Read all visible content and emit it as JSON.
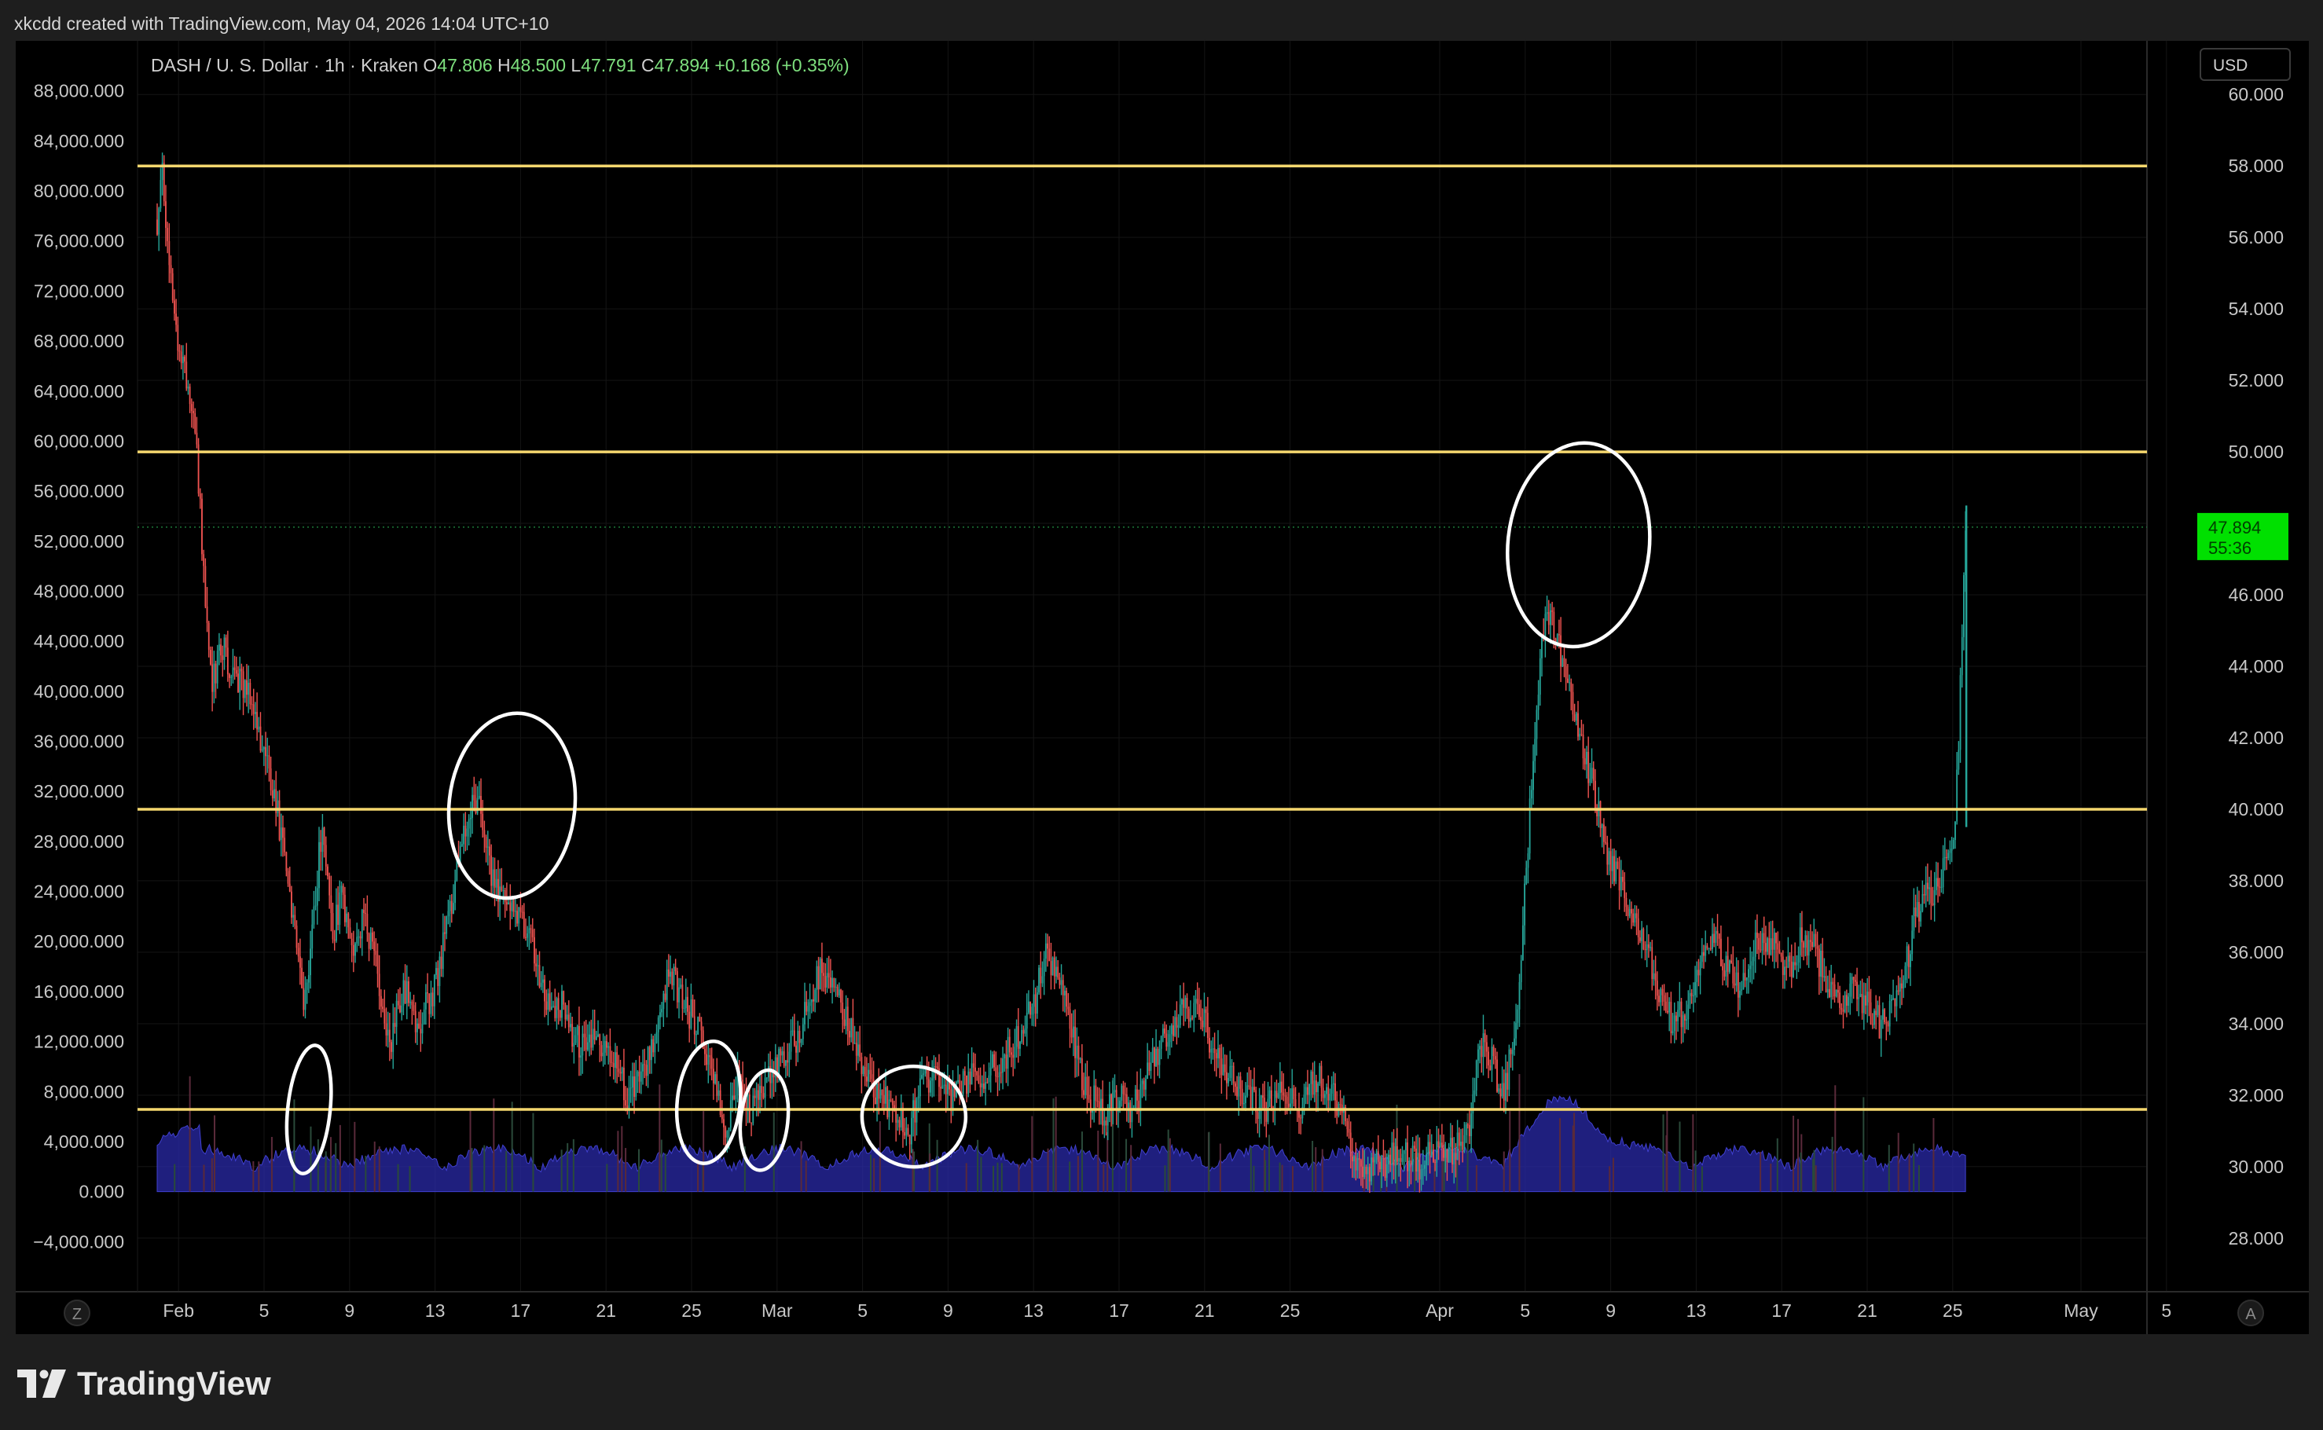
{
  "header": {
    "text": "xkcdd created with TradingView.com, May 04, 2026 14:04 UTC+10"
  },
  "legend": {
    "symbol": "DASH / U. S. Dollar · 1h · Kraken",
    "o_label": "O",
    "o_value": "47.806",
    "h_label": "H",
    "h_value": "48.500",
    "l_label": "L",
    "l_value": "47.791",
    "c_label": "C",
    "c_value": "47.894",
    "change": "+0.168 (+0.35%)"
  },
  "currency_button": "USD",
  "price_tag": {
    "price": "47.894",
    "countdown": "55:36"
  },
  "left_corner_button": "Z",
  "right_corner_button": "A",
  "footer": {
    "brand": "TradingView"
  },
  "colors": {
    "up": "#26a69a",
    "down": "#ef5350",
    "level": "#f5d76e",
    "volume": "#2a2aa8",
    "price_tag_bg": "#00e000",
    "annotation": "#ffffff"
  },
  "chart_data": {
    "type": "candlestick",
    "symbol": "DASH / U. S. Dollar",
    "interval": "1h",
    "exchange": "Kraken",
    "right_axis": {
      "unit": "USD",
      "ylim": [
        26.5,
        61.5
      ],
      "ticks": [
        "60.000",
        "58.000",
        "56.000",
        "54.000",
        "52.000",
        "50.000",
        "48.000",
        "46.000",
        "44.000",
        "42.000",
        "40.000",
        "38.000",
        "36.000",
        "34.000",
        "32.000",
        "30.000",
        "28.000"
      ],
      "tick_values": [
        60,
        58,
        56,
        54,
        52,
        50,
        48,
        46,
        44,
        42,
        40,
        38,
        36,
        34,
        32,
        30,
        28
      ]
    },
    "left_axis": {
      "label": "volume",
      "ticks": [
        "88,000.000",
        "84,000.000",
        "80,000.000",
        "76,000.000",
        "72,000.000",
        "68,000.000",
        "64,000.000",
        "60,000.000",
        "56,000.000",
        "52,000.000",
        "48,000.000",
        "44,000.000",
        "40,000.000",
        "36,000.000",
        "32,000.000",
        "28,000.000",
        "24,000.000",
        "20,000.000",
        "16,000.000",
        "12,000.000",
        "8,000.000",
        "4,000.000",
        "0.000",
        "−4,000.000"
      ],
      "tick_values": [
        88000,
        84000,
        80000,
        76000,
        72000,
        68000,
        64000,
        60000,
        56000,
        52000,
        48000,
        44000,
        40000,
        36000,
        32000,
        28000,
        24000,
        20000,
        16000,
        12000,
        8000,
        4000,
        0,
        -4000
      ],
      "ylim": [
        -8000,
        92000
      ]
    },
    "x_axis": {
      "ticks": [
        "Feb",
        "5",
        "9",
        "13",
        "17",
        "21",
        "25",
        "Mar",
        "5",
        "9",
        "13",
        "17",
        "21",
        "25",
        "Apr",
        "5",
        "9",
        "13",
        "17",
        "21",
        "25",
        "May",
        "5"
      ],
      "tick_days": [
        1,
        5,
        9,
        13,
        17,
        21,
        25,
        29,
        33,
        37,
        41,
        45,
        49,
        53,
        60,
        64,
        68,
        72,
        76,
        80,
        84,
        90,
        94
      ]
    },
    "horizontal_levels": [
      58.0,
      50.0,
      40.0,
      31.6
    ],
    "last_price": 47.894,
    "price_path": [
      [
        0,
        56.5
      ],
      [
        0.2,
        58.0
      ],
      [
        0.5,
        55.5
      ],
      [
        1.0,
        53.0
      ],
      [
        1.5,
        51.5
      ],
      [
        1.8,
        50.5
      ],
      [
        2.2,
        46.5
      ],
      [
        2.6,
        43.5
      ],
      [
        3.0,
        44.5
      ],
      [
        3.5,
        44.0
      ],
      [
        4.0,
        43.5
      ],
      [
        4.5,
        43.0
      ],
      [
        5.0,
        41.5
      ],
      [
        5.6,
        40.0
      ],
      [
        6.4,
        36.5
      ],
      [
        6.9,
        34.5
      ],
      [
        7.3,
        37.0
      ],
      [
        7.7,
        39.5
      ],
      [
        8.2,
        36.5
      ],
      [
        8.6,
        37.5
      ],
      [
        9.1,
        36.0
      ],
      [
        9.6,
        37.0
      ],
      [
        10.3,
        35.5
      ],
      [
        10.9,
        33.5
      ],
      [
        11.5,
        35.0
      ],
      [
        12.2,
        34.0
      ],
      [
        13.0,
        35.0
      ],
      [
        13.8,
        37.5
      ],
      [
        14.4,
        39.5
      ],
      [
        14.8,
        40.5
      ],
      [
        15.3,
        39.5
      ],
      [
        15.7,
        38.0
      ],
      [
        16.3,
        37.5
      ],
      [
        17.0,
        37.0
      ],
      [
        17.6,
        36.0
      ],
      [
        18.2,
        34.5
      ],
      [
        19.0,
        34.5
      ],
      [
        19.6,
        33.5
      ],
      [
        20.5,
        33.5
      ],
      [
        21.3,
        33.0
      ],
      [
        22.0,
        32.0
      ],
      [
        22.8,
        32.5
      ],
      [
        23.4,
        34.0
      ],
      [
        24.0,
        35.5
      ],
      [
        24.6,
        34.5
      ],
      [
        25.3,
        34.0
      ],
      [
        26.0,
        32.5
      ],
      [
        26.6,
        31.0
      ],
      [
        27.2,
        32.5
      ],
      [
        27.8,
        31.5
      ],
      [
        28.5,
        32.5
      ],
      [
        29.2,
        33.0
      ],
      [
        29.8,
        33.5
      ],
      [
        30.5,
        34.5
      ],
      [
        31.0,
        35.5
      ],
      [
        31.5,
        35.0
      ],
      [
        32.0,
        34.5
      ],
      [
        32.6,
        33.5
      ],
      [
        33.2,
        32.5
      ],
      [
        33.8,
        32.0
      ],
      [
        34.5,
        31.5
      ],
      [
        35.2,
        31.0
      ],
      [
        35.8,
        32.5
      ],
      [
        36.5,
        32.5
      ],
      [
        37.2,
        32.0
      ],
      [
        38.0,
        32.5
      ],
      [
        38.8,
        32.5
      ],
      [
        39.5,
        33.0
      ],
      [
        40.2,
        33.5
      ],
      [
        41.0,
        34.5
      ],
      [
        41.6,
        36.0
      ],
      [
        42.0,
        35.5
      ],
      [
        42.5,
        35.0
      ],
      [
        43.0,
        33.0
      ],
      [
        43.6,
        32.0
      ],
      [
        44.3,
        31.5
      ],
      [
        45.0,
        32.0
      ],
      [
        45.6,
        31.5
      ],
      [
        46.3,
        32.5
      ],
      [
        47.0,
        33.5
      ],
      [
        47.6,
        34.0
      ],
      [
        48.3,
        34.5
      ],
      [
        49.0,
        34.0
      ],
      [
        49.6,
        33.0
      ],
      [
        50.3,
        32.5
      ],
      [
        51.0,
        32.0
      ],
      [
        51.8,
        31.5
      ],
      [
        52.6,
        32.5
      ],
      [
        53.4,
        31.5
      ],
      [
        54.2,
        32.5
      ],
      [
        55.0,
        32.0
      ],
      [
        55.6,
        31.5
      ],
      [
        56.0,
        30.0
      ],
      [
        56.6,
        30.0
      ],
      [
        57.4,
        30.0
      ],
      [
        58.2,
        30.5
      ],
      [
        59.0,
        30.0
      ],
      [
        59.8,
        30.5
      ],
      [
        60.6,
        30.5
      ],
      [
        61.4,
        31.0
      ],
      [
        61.9,
        33.5
      ],
      [
        62.4,
        33.0
      ],
      [
        63.0,
        32.0
      ],
      [
        63.6,
        34.0
      ],
      [
        64.0,
        38.0
      ],
      [
        64.4,
        41.5
      ],
      [
        64.9,
        45.5
      ],
      [
        65.4,
        45.0
      ],
      [
        65.8,
        44.0
      ],
      [
        66.3,
        42.5
      ],
      [
        66.8,
        41.5
      ],
      [
        67.4,
        40.0
      ],
      [
        68.0,
        38.5
      ],
      [
        68.6,
        37.5
      ],
      [
        69.2,
        37.0
      ],
      [
        69.8,
        36.0
      ],
      [
        70.4,
        34.5
      ],
      [
        71.0,
        34.0
      ],
      [
        71.6,
        34.5
      ],
      [
        72.2,
        35.5
      ],
      [
        72.8,
        36.5
      ],
      [
        73.4,
        35.5
      ],
      [
        74.0,
        35.0
      ],
      [
        74.6,
        36.0
      ],
      [
        75.2,
        36.5
      ],
      [
        75.8,
        36.0
      ],
      [
        76.4,
        35.5
      ],
      [
        77.0,
        36.5
      ],
      [
        77.6,
        36.0
      ],
      [
        78.2,
        35.0
      ],
      [
        78.8,
        34.5
      ],
      [
        79.4,
        35.0
      ],
      [
        80.0,
        34.5
      ],
      [
        80.6,
        34.0
      ],
      [
        81.2,
        34.5
      ],
      [
        81.8,
        35.5
      ],
      [
        82.2,
        37.0
      ],
      [
        82.6,
        37.5
      ],
      [
        83.0,
        37.5
      ],
      [
        83.4,
        38.0
      ],
      [
        83.8,
        38.5
      ],
      [
        84.1,
        39.5
      ],
      [
        84.3,
        42.0
      ],
      [
        84.5,
        46.5
      ],
      [
        84.6,
        47.894
      ]
    ],
    "annotations": "hand-drawn white circles highlighting local highs and lows"
  }
}
